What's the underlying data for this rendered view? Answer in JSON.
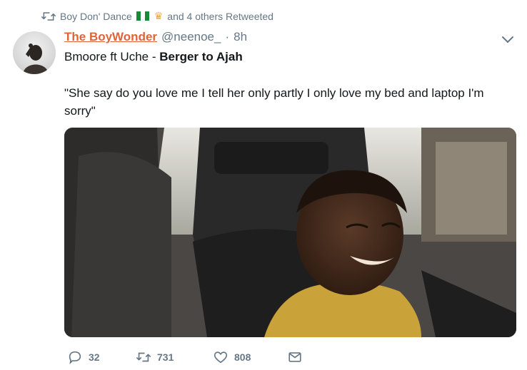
{
  "retweet_context": {
    "icon": "retweet-icon",
    "name": "Boy Don' Dance",
    "suffix": "and 4 others Retweeted"
  },
  "tweet": {
    "display_name": "The BoyWonder",
    "handle": "@neenoe_",
    "separator": "·",
    "timestamp": "8h",
    "song_prefix": "Bmoore ft Uche - ",
    "song_title": "Berger to Ajah",
    "text": "\"She say do you love me I tell her only partly I only love my bed and laptop I'm sorry\"",
    "media_description_icon": "photo-child-in-car"
  },
  "actions": {
    "reply_count": "32",
    "retweet_count": "731",
    "like_count": "808"
  },
  "colors": {
    "name_accent": "#e0643a",
    "muted": "#657786"
  }
}
